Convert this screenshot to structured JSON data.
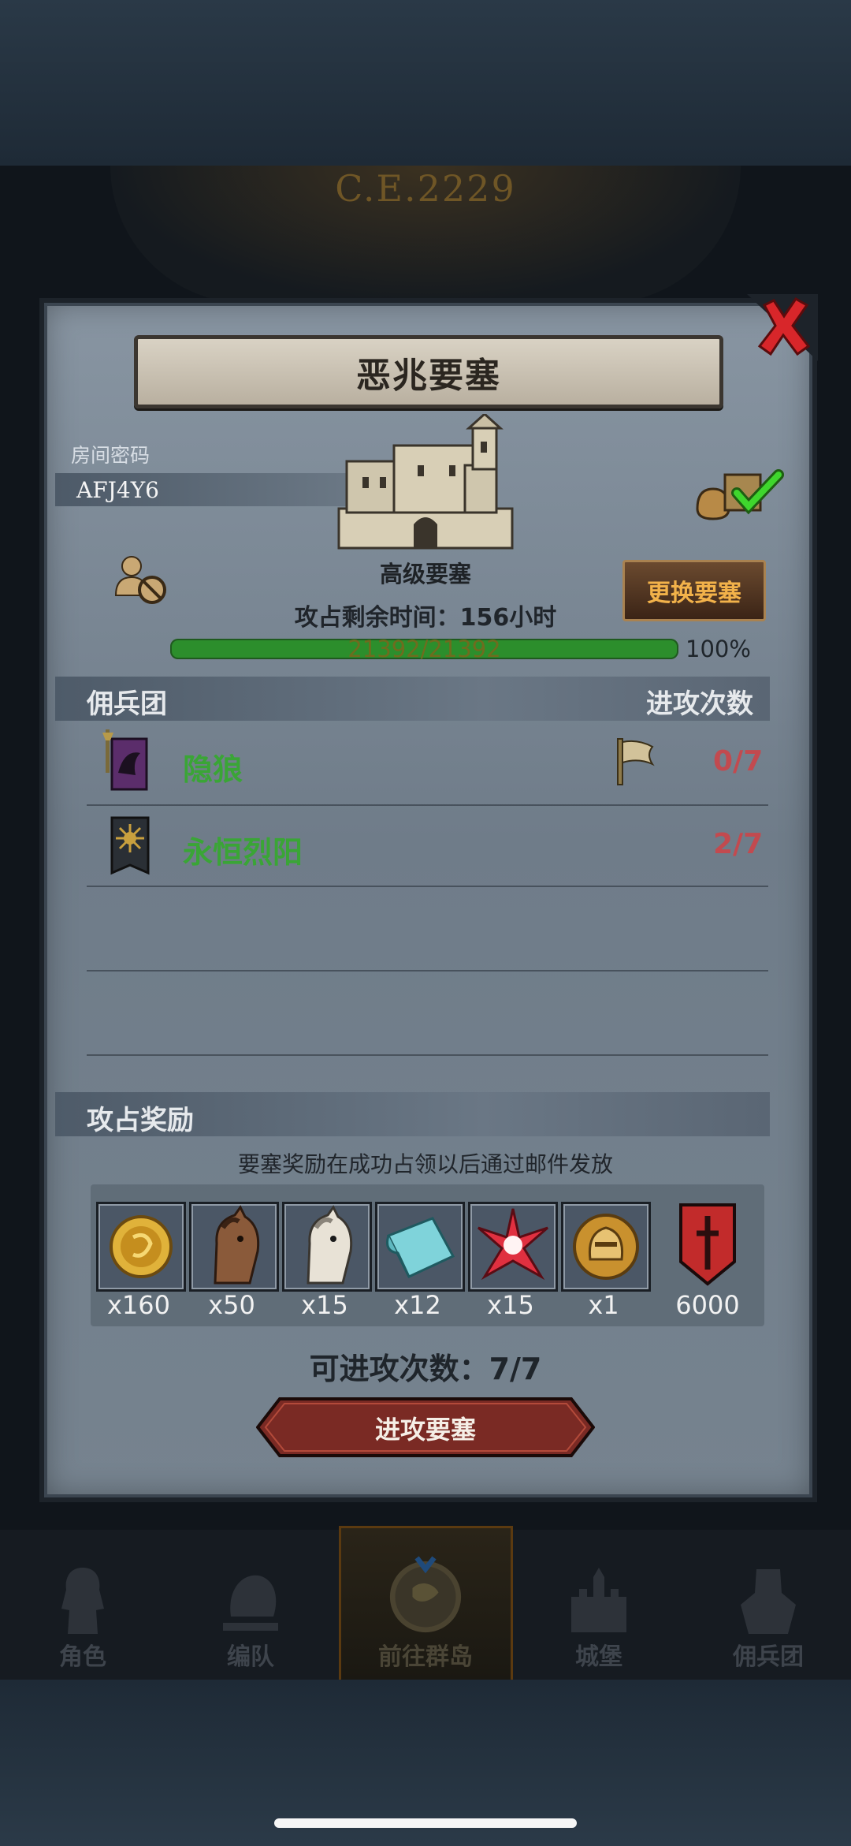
{
  "banner": {
    "year": "C.E.2229"
  },
  "dialog": {
    "title": "恶兆要塞",
    "room_label": "房间密码",
    "room_code": "AFJ4Y6",
    "fortress_level": "高级要塞",
    "change_button": "更换要塞",
    "time_text": "攻占剩余时间：156小时",
    "hp_text": "21392/21392",
    "hp_percent": "100%",
    "hp_fraction": 1.0,
    "merc_header": "佣兵团",
    "attack_header": "进攻次数",
    "guilds": [
      {
        "name": "隐狼",
        "count": "0/7",
        "flag": true
      },
      {
        "name": "永恒烈阳",
        "count": "2/7",
        "flag": false
      }
    ],
    "reward_header": "攻占奖励",
    "reward_note": "要塞奖励在成功占领以后通过邮件发放",
    "rewards": [
      {
        "icon": "gold-coin-icon",
        "amount": "x160"
      },
      {
        "icon": "brown-horse-icon",
        "amount": "x50"
      },
      {
        "icon": "white-horse-icon",
        "amount": "x15"
      },
      {
        "icon": "cloth-roll-icon",
        "amount": "x12"
      },
      {
        "icon": "red-star-icon",
        "amount": "x15"
      },
      {
        "icon": "knight-medal-icon",
        "amount": "x1"
      },
      {
        "icon": "red-banner-icon",
        "amount": "6000"
      }
    ],
    "attempts_text": "可进攻次数：7/7",
    "attack_button": "进攻要塞"
  },
  "nav": {
    "items": [
      {
        "label": "角色"
      },
      {
        "label": "编队"
      },
      {
        "label": "前往群岛"
      },
      {
        "label": "城堡"
      },
      {
        "label": "佣兵团"
      }
    ]
  },
  "colors": {
    "accent": "#c24a4f",
    "guild_green": "#3aa536",
    "button_gold": "#f2b24a"
  }
}
